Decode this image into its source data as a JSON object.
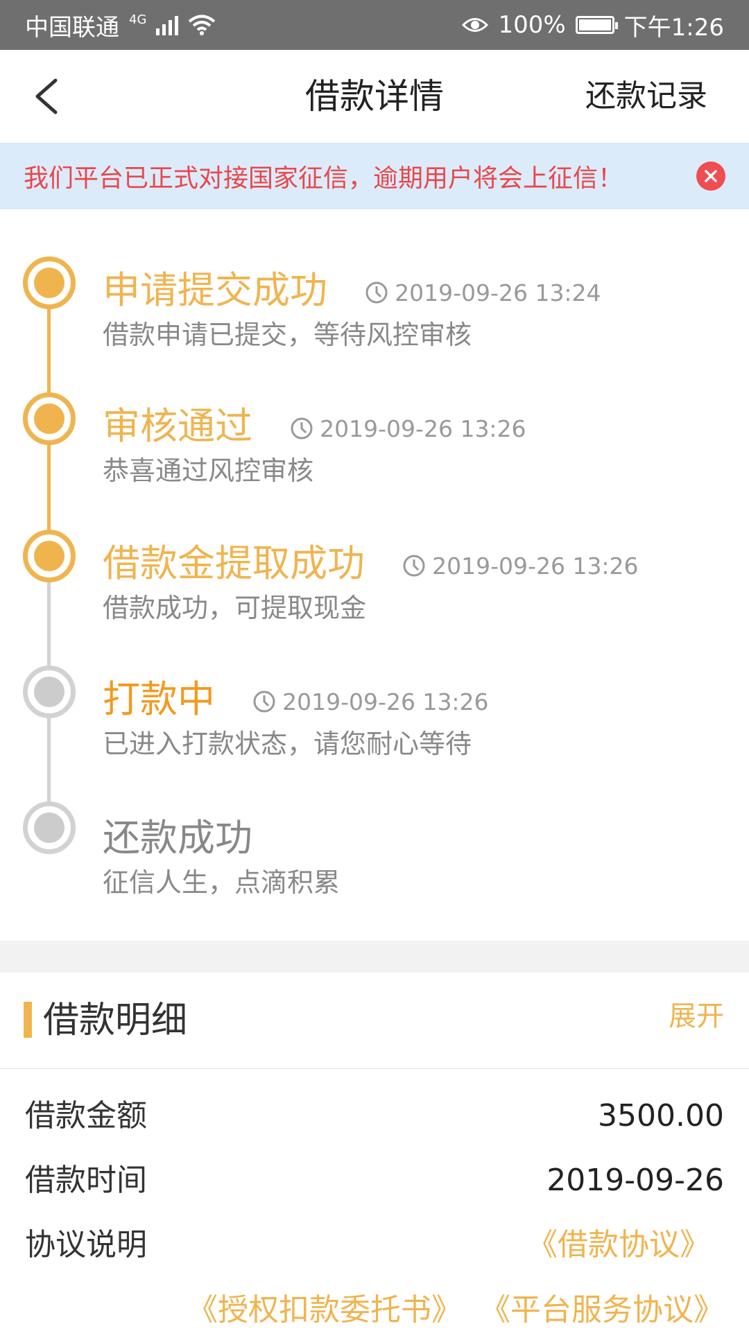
{
  "status_bar": {
    "carrier": "中国联通",
    "network": "4G",
    "battery": "100%",
    "time": "下午1:26"
  },
  "nav": {
    "title": "借款详情",
    "right_action": "还款记录"
  },
  "notice": {
    "text": "我们平台已正式对接国家征信，逾期用户将会上征信！"
  },
  "timeline": [
    {
      "title": "申请提交成功",
      "time": "2019-09-26 13:24",
      "desc": "借款申请已提交，等待风控审核",
      "state": "done"
    },
    {
      "title": "审核通过",
      "time": "2019-09-26 13:26",
      "desc": "恭喜通过风控审核",
      "state": "done"
    },
    {
      "title": "借款金提取成功",
      "time": "2019-09-26 13:26",
      "desc": "借款成功，可提取现金",
      "state": "done"
    },
    {
      "title": "打款中",
      "time": "2019-09-26 13:26",
      "desc": "已进入打款状态，请您耐心等待",
      "state": "current"
    },
    {
      "title": "还款成功",
      "time": "",
      "desc": "征信人生，点滴积累",
      "state": "pending"
    }
  ],
  "detail": {
    "title": "借款明细",
    "expand_label": "展开",
    "amount_label": "借款金额",
    "amount_value": "3500.00",
    "date_label": "借款时间",
    "date_value": "2019-09-26",
    "agreement_label": "协议说明",
    "agreements": [
      "《借款协议》",
      "《授权扣款委托书》",
      "《平台服务协议》"
    ]
  },
  "colors": {
    "accent": "#f0b44f",
    "current_title": "#f29a1f",
    "pending": "#cccccc",
    "notice_text": "#e8474a",
    "notice_bg": "#dcebf9"
  }
}
